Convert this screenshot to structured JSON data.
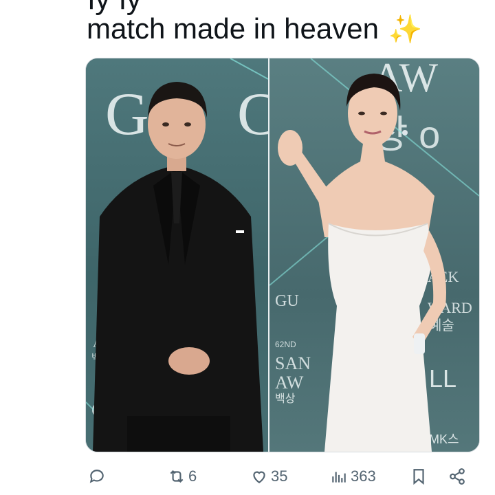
{
  "tweet": {
    "top_cut_text": "ly          ly",
    "text": "match made in heaven",
    "emoji": "✨"
  },
  "media": {
    "left_photo": {
      "alt_text_visible": "",
      "backdrop_letters": [
        "G",
        "C",
        "A",
        "백상"
      ],
      "signage": "GUCCI"
    },
    "right_photo": {
      "backdrop_letters": [
        "AW",
        "상 o",
        "AEK",
        "G",
        "WARD",
        "예술",
        "62ND",
        "SAN",
        "AW",
        "백상",
        "LL",
        "MK스"
      ]
    }
  },
  "actions": {
    "reply": {
      "icon": "reply-icon",
      "count": ""
    },
    "retweet": {
      "icon": "retweet-icon",
      "count": "6"
    },
    "like": {
      "icon": "heart-icon",
      "count": "35"
    },
    "views": {
      "icon": "views-icon",
      "count": "363"
    },
    "bookmark": {
      "icon": "bookmark-icon"
    },
    "share": {
      "icon": "share-icon"
    }
  },
  "colors": {
    "text": "#0f1419",
    "muted": "#536471",
    "backdrop": "#4a6f73"
  }
}
